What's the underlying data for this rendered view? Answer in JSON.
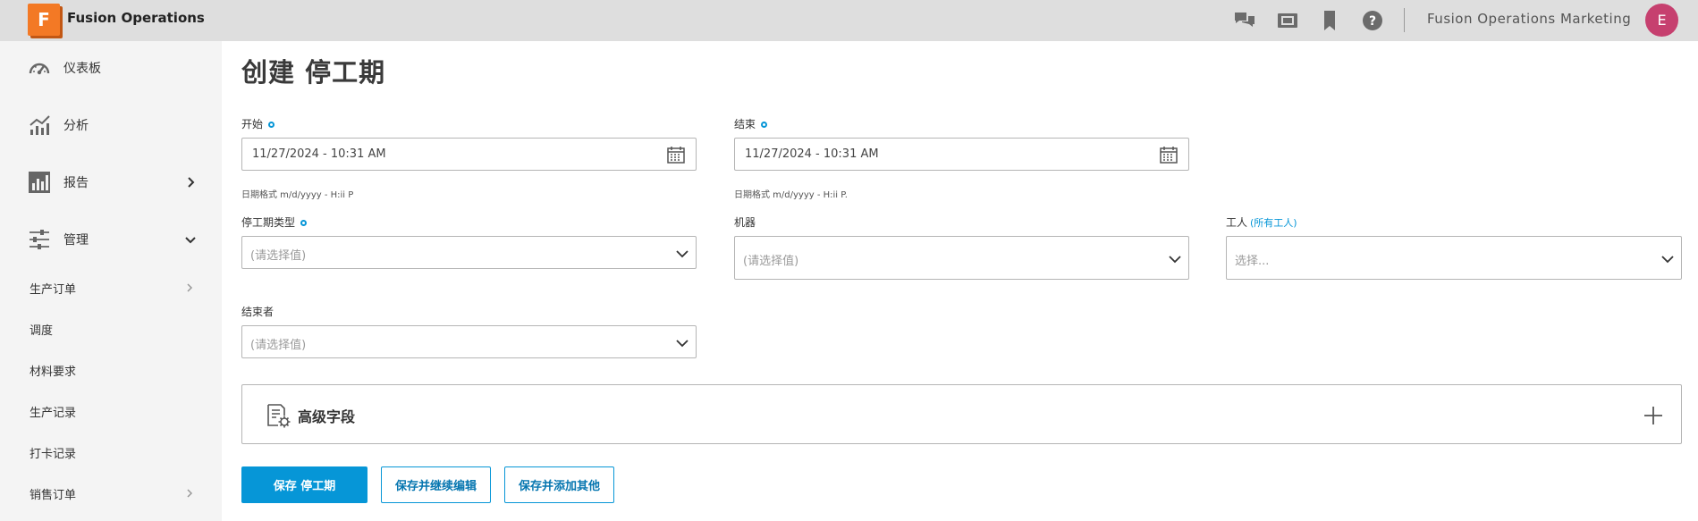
{
  "app": {
    "logo_letter": "F",
    "title": "Fusion Operations"
  },
  "header": {
    "org_name": "Fusion Operations Marketing",
    "avatar_letter": "E",
    "icons": [
      "chat-icon",
      "media-icon",
      "bookmark-icon",
      "help-icon"
    ]
  },
  "sidebar": {
    "main_items": [
      {
        "label": "仪表板",
        "icon": "dashboard-icon"
      },
      {
        "label": "分析",
        "icon": "analytics-icon"
      },
      {
        "label": "报告",
        "icon": "reports-icon",
        "chevron": "right"
      },
      {
        "label": "管理",
        "icon": "settings-sliders-icon",
        "chevron": "down"
      }
    ],
    "sub_items": [
      {
        "label": "生产订单",
        "chevron": true
      },
      {
        "label": "调度",
        "chevron": false
      },
      {
        "label": "材料要求",
        "chevron": false
      },
      {
        "label": "生产记录",
        "chevron": false
      },
      {
        "label": "打卡记录",
        "chevron": false
      },
      {
        "label": "销售订单",
        "chevron": true
      }
    ]
  },
  "page": {
    "title": "创建 停工期"
  },
  "form": {
    "start": {
      "label": "开始",
      "value": "11/27/2024 - 10:31 AM",
      "hint": "日期格式 m/d/yyyy - H:ii P"
    },
    "end": {
      "label": "结束",
      "value": "11/27/2024 - 10:31 AM",
      "hint": "日期格式 m/d/yyyy - H:ii P."
    },
    "downtime_type": {
      "label": "停工期类型",
      "placeholder": "(请选择值)"
    },
    "machine": {
      "label": "机器",
      "placeholder": "(请选择值)"
    },
    "worker": {
      "label": "工人",
      "label_extra": "(所有工人)",
      "placeholder": "选择..."
    },
    "ended_by": {
      "label": "结束者",
      "placeholder": "(请选择值)"
    }
  },
  "advanced": {
    "title": "高级字段"
  },
  "buttons": {
    "save": "保存 停工期",
    "save_continue": "保存并继续编辑",
    "save_add": "保存并添加其他"
  },
  "colors": {
    "accent": "#0696d7",
    "logo": "#f37925",
    "avatar": "#c6406f",
    "topbar": "#dedede",
    "sidebar": "#f4f4f4"
  }
}
